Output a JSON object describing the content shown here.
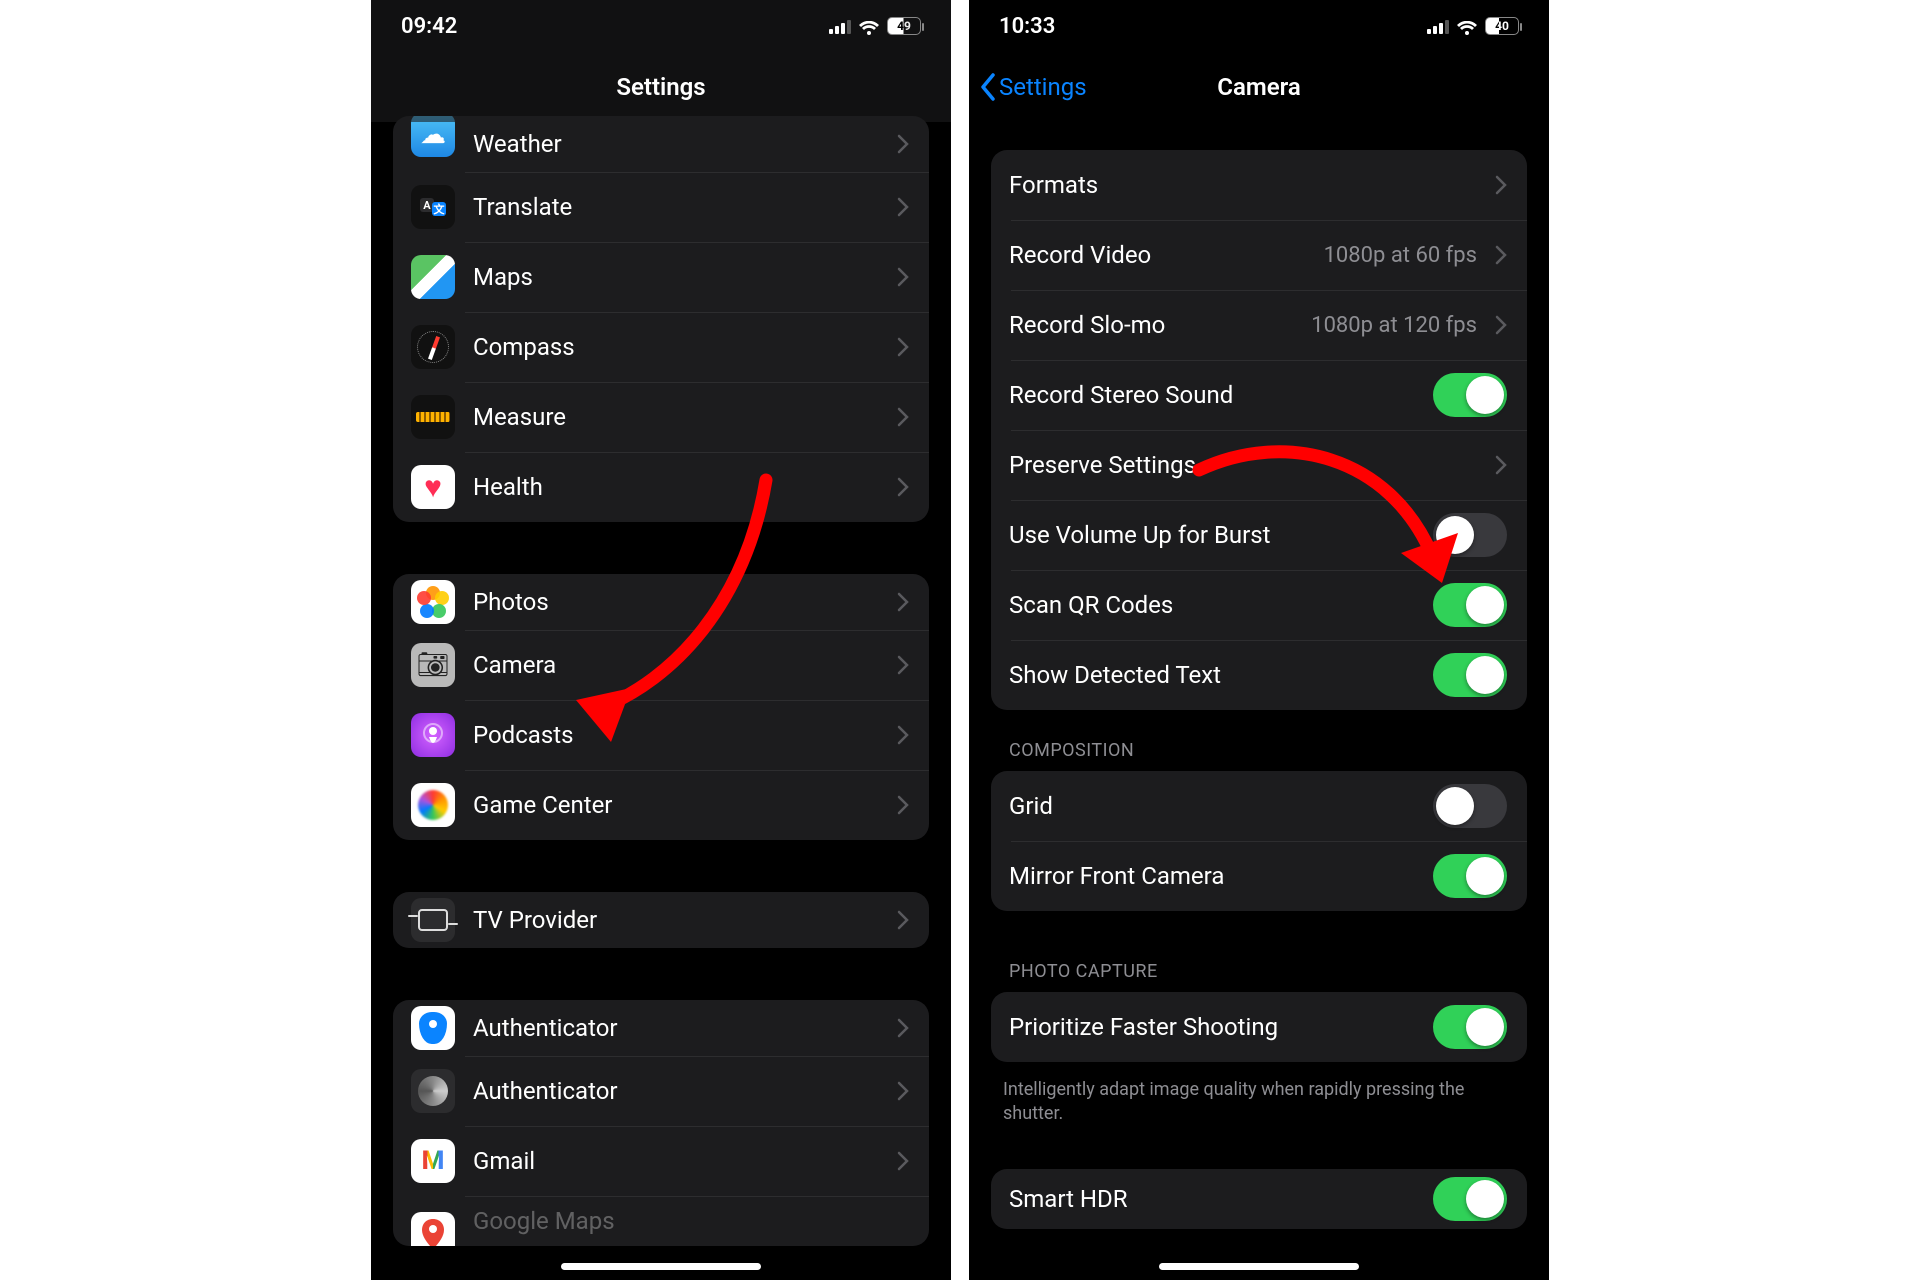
{
  "left": {
    "status": {
      "time": "09:42",
      "battery": "49"
    },
    "nav": {
      "title": "Settings"
    },
    "groups": [
      {
        "rows": [
          {
            "id": "weather",
            "label": "Weather"
          },
          {
            "id": "translate",
            "label": "Translate"
          },
          {
            "id": "maps",
            "label": "Maps"
          },
          {
            "id": "compass",
            "label": "Compass"
          },
          {
            "id": "measure",
            "label": "Measure"
          },
          {
            "id": "health",
            "label": "Health"
          }
        ]
      },
      {
        "rows": [
          {
            "id": "photos",
            "label": "Photos"
          },
          {
            "id": "camera",
            "label": "Camera"
          },
          {
            "id": "podcasts",
            "label": "Podcasts"
          },
          {
            "id": "gamecenter",
            "label": "Game Center"
          }
        ]
      },
      {
        "rows": [
          {
            "id": "tvprovider",
            "label": "TV Provider"
          }
        ]
      },
      {
        "rows": [
          {
            "id": "auth1",
            "label": "Authenticator"
          },
          {
            "id": "auth2",
            "label": "Authenticator"
          },
          {
            "id": "gmail",
            "label": "Gmail"
          },
          {
            "id": "gmaps",
            "label": "Google Maps"
          }
        ]
      }
    ]
  },
  "right": {
    "status": {
      "time": "10:33",
      "battery": "40"
    },
    "nav": {
      "back": "Settings",
      "title": "Camera"
    },
    "group1": [
      {
        "label": "Formats",
        "type": "chevron"
      },
      {
        "label": "Record Video",
        "type": "chevron",
        "value": "1080p at 60 fps"
      },
      {
        "label": "Record Slo-mo",
        "type": "chevron",
        "value": "1080p at 120 fps"
      },
      {
        "label": "Record Stereo Sound",
        "type": "toggle",
        "on": true
      },
      {
        "label": "Preserve Settings",
        "type": "chevron"
      },
      {
        "label": "Use Volume Up for Burst",
        "type": "toggle",
        "on": false
      },
      {
        "label": "Scan QR Codes",
        "type": "toggle",
        "on": true
      },
      {
        "label": "Show Detected Text",
        "type": "toggle",
        "on": true
      }
    ],
    "section_composition": "COMPOSITION",
    "group2": [
      {
        "label": "Grid",
        "type": "toggle",
        "on": false
      },
      {
        "label": "Mirror Front Camera",
        "type": "toggle",
        "on": true
      }
    ],
    "section_photo": "PHOTO CAPTURE",
    "group3": [
      {
        "label": "Prioritize Faster Shooting",
        "type": "toggle",
        "on": true
      }
    ],
    "footnote": "Intelligently adapt image quality when rapidly pressing the shutter.",
    "group4": [
      {
        "label": "Smart HDR",
        "type": "toggle",
        "on": true
      }
    ]
  }
}
